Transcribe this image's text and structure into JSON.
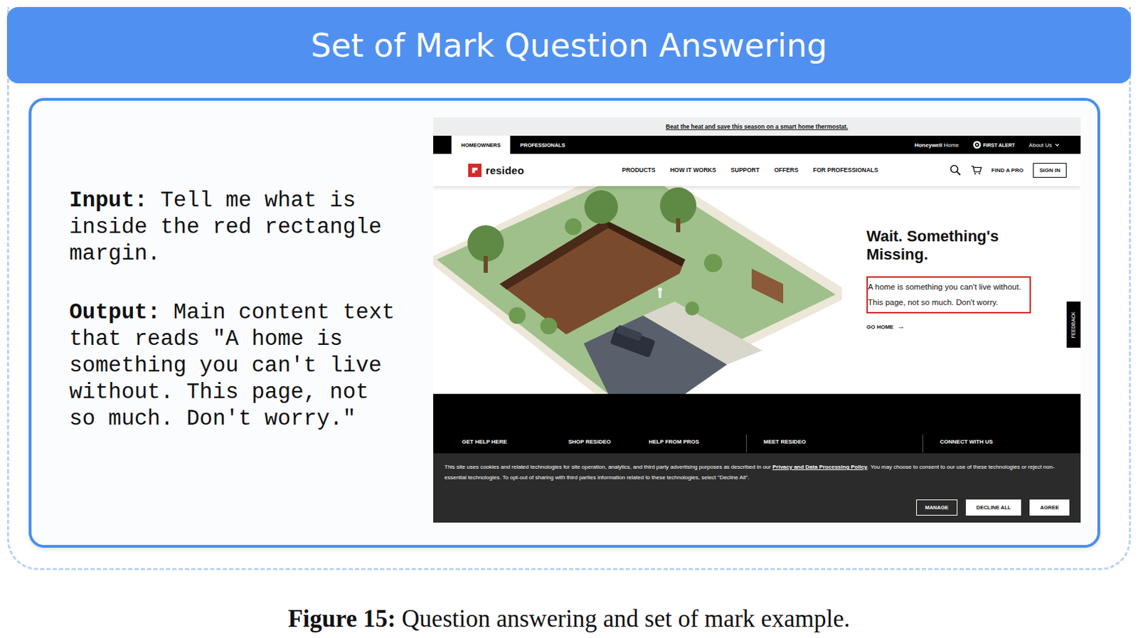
{
  "figure": {
    "title": "Set of Mark Question Answering",
    "caption_label": "Figure 15:",
    "caption_text": "Question answering and set of mark example."
  },
  "qa": {
    "input_label": "Input:",
    "input_text": "Tell me what is inside the red rectangle margin.",
    "output_label": "Output:",
    "output_text": "Main content text that reads \"A home is something you can't live without. This page, not so much. Don't worry.\""
  },
  "screenshot": {
    "promo": "Beat the heat and save this season on a smart home thermostat.",
    "audience_tabs": [
      {
        "label": "HOMEOWNERS",
        "selected": true
      },
      {
        "label": "PROFESSIONALS",
        "selected": false
      }
    ],
    "brands": {
      "honeywell_bold": "Honeywell",
      "honeywell_light": "Home",
      "first_alert": "FIRST ALERT",
      "about": "About Us"
    },
    "logo": "resideo",
    "nav": [
      "PRODUCTS",
      "HOW IT WORKS",
      "SUPPORT",
      "OFFERS",
      "FOR PROFESSIONALS"
    ],
    "actions": {
      "find_pro": "FIND A PRO",
      "sign_in": "SIGN IN"
    },
    "hero": {
      "heading": "Wait. Something's Missing.",
      "marked": true,
      "body_lines": [
        "A home is something you can't live without.",
        "This page, not so much. Don't worry."
      ],
      "link": "GO HOME",
      "link_arrow": "→"
    },
    "feedback": "FEEDBACK",
    "footer_columns": [
      "GET HELP HERE",
      "SHOP RESIDEO",
      "HELP FROM PROS",
      "MEET RESIDEO",
      "CONNECT WITH US"
    ],
    "cookie": {
      "text_before": "This site uses cookies and related technologies for site operation, analytics, and third party advertising purposes as described in our ",
      "link": "Privacy and Data Processing Policy",
      "text_after": ". You may choose to consent to our use of these technologies or reject non-essential technologies. To opt-out of sharing with third parties information related to these technologies, select \"Decline All\".",
      "buttons": [
        {
          "label": "MANAGE",
          "kind": "outline"
        },
        {
          "label": "DECLINE ALL",
          "kind": "solid"
        },
        {
          "label": "AGREE",
          "kind": "solid"
        }
      ]
    }
  }
}
